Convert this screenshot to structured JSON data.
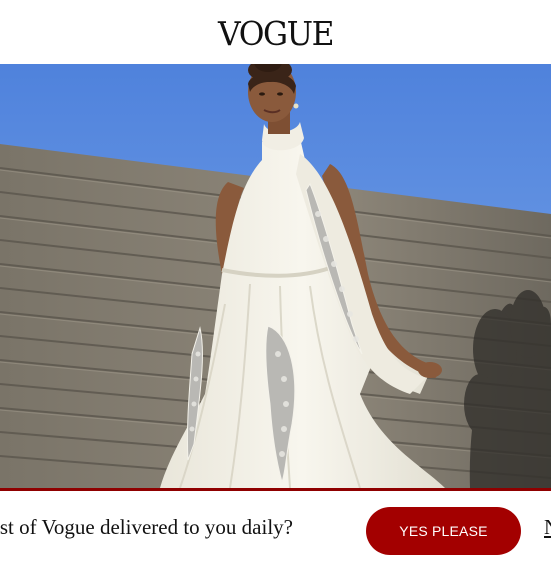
{
  "header": {
    "logo_text": "VOGUE"
  },
  "hero": {
    "image_subject": "woman-in-white-embellished-gown-photo"
  },
  "newsletter_banner": {
    "prompt_text": "best of Vogue delivered to you daily?",
    "accept_label": "YES PLEASE",
    "decline_label": "N"
  },
  "colors": {
    "accent": "#a30000",
    "banner_border": "#8f0000",
    "sky": "#5f8fe0"
  }
}
